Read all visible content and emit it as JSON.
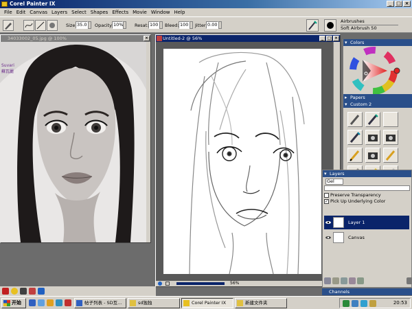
{
  "app": {
    "title": "Corel Painter IX"
  },
  "menu": [
    "File",
    "Edit",
    "Canvas",
    "Layers",
    "Select",
    "Shapes",
    "Effects",
    "Movie",
    "Window",
    "Help"
  ],
  "property_bar": {
    "size_label": "Size:",
    "size_value": "35.0",
    "opacity_label": "Opacity:",
    "opacity_value": "10%",
    "resat_label": "Resat:",
    "resat_value": "100",
    "bleed_label": "Bleed:",
    "bleed_value": "100",
    "jitter_label": "Jitter:",
    "jitter_value": "0.00",
    "brush_category": "Airbrushes",
    "brush_variant": "Soft Airbrush 50"
  },
  "documents": {
    "reference": {
      "title": "34033002_05.jpg @ 100%",
      "watermark": [
        "Suvari",
        "蘇瓦麗"
      ]
    },
    "canvas": {
      "title": "Untitled-2 @ 56%",
      "zoom": "56%"
    }
  },
  "panels": {
    "colors": "Colors",
    "papers": "Papers",
    "custom": "Custom 2",
    "layers": "Layers",
    "layers_tab": "Gel",
    "preserve_transparency": "Preserve Transparency",
    "pick_up_underlying": "Pick Up Underlying Color",
    "layer_items": [
      "Layer 1",
      "Canvas"
    ],
    "channels": "Channels"
  },
  "taskbar": {
    "start": "开始",
    "tasks": [
      "帖子列表 - SD互...",
      "sd独独",
      "Corel Painter IX",
      "新建文件夹"
    ],
    "clock": "20:53"
  },
  "colors": {
    "titlebar": "#0a246a",
    "panel_title": "#2a4f8a",
    "chrome": "#d4d0c8"
  }
}
